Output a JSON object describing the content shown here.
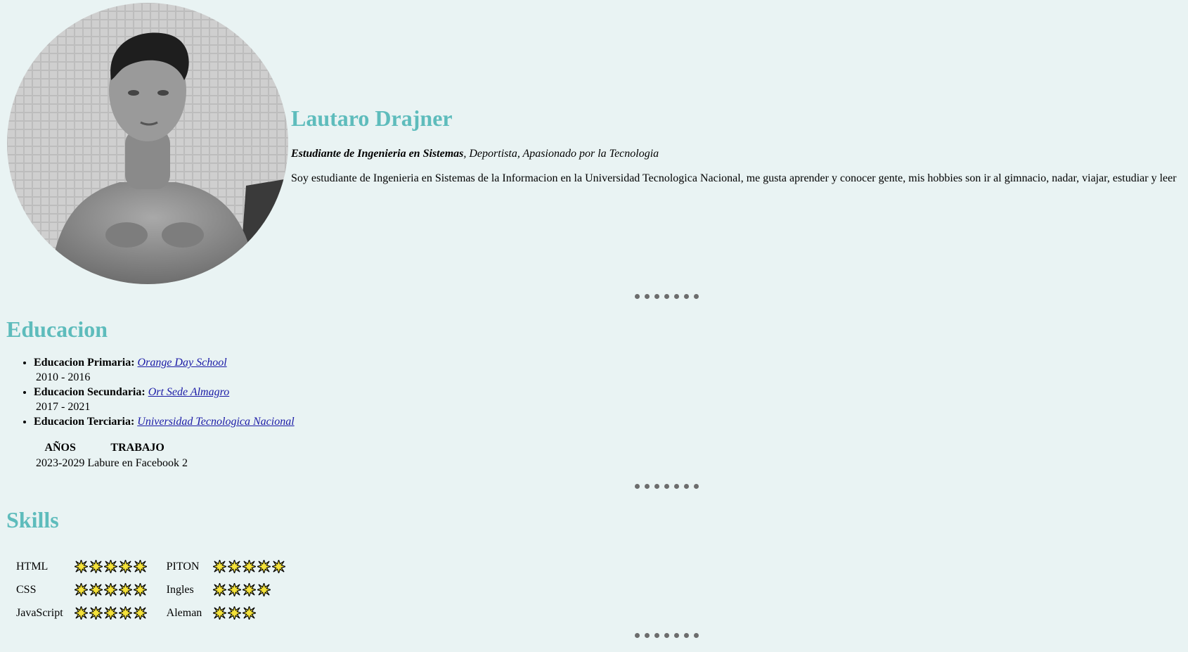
{
  "profile": {
    "name": "Lautaro Drajner",
    "tagline_bold": "Estudiante de Ingenieria en Sistemas",
    "tagline_rest": ", Deportista, Apasionado por la Tecnologia",
    "bio": "Soy estudiante de Ingenieria en Sistemas de la Informacion en la Universidad Tecnologica Nacional, me gusta aprender y conocer gente, mis hobbies son ir al gimnacio, nadar, viajar, estudiar y leer"
  },
  "education": {
    "title": "Educacion",
    "items": [
      {
        "label": "Educacion Primaria:",
        "school": "Orange Day School",
        "years": "2010 - 2016"
      },
      {
        "label": "Educacion Secundaria:",
        "school": "Ort Sede Almagro",
        "years": "2017 - 2021"
      },
      {
        "label": "Educacion Terciaria:",
        "school": "Universidad Tecnologica Nacional",
        "years": ""
      }
    ],
    "jobs_table": {
      "headers": [
        "AÑOS",
        "TRABAJO"
      ],
      "rows": [
        [
          "2023-2029",
          "Labure en Facebook 2"
        ]
      ]
    }
  },
  "skills": {
    "title": "Skills",
    "rows": [
      {
        "left_name": "HTML",
        "left_stars": 5,
        "right_name": "PITON",
        "right_stars": 5
      },
      {
        "left_name": "CSS",
        "left_stars": 5,
        "right_name": "Ingles",
        "right_stars": 4
      },
      {
        "left_name": "JavaScript",
        "left_stars": 5,
        "right_name": "Aleman",
        "right_stars": 3
      }
    ]
  },
  "colors": {
    "background": "#e9f3f3",
    "accent": "#5ebcbc",
    "divider_dot": "#6c6c6c",
    "star_fill": "#f4e23a"
  }
}
